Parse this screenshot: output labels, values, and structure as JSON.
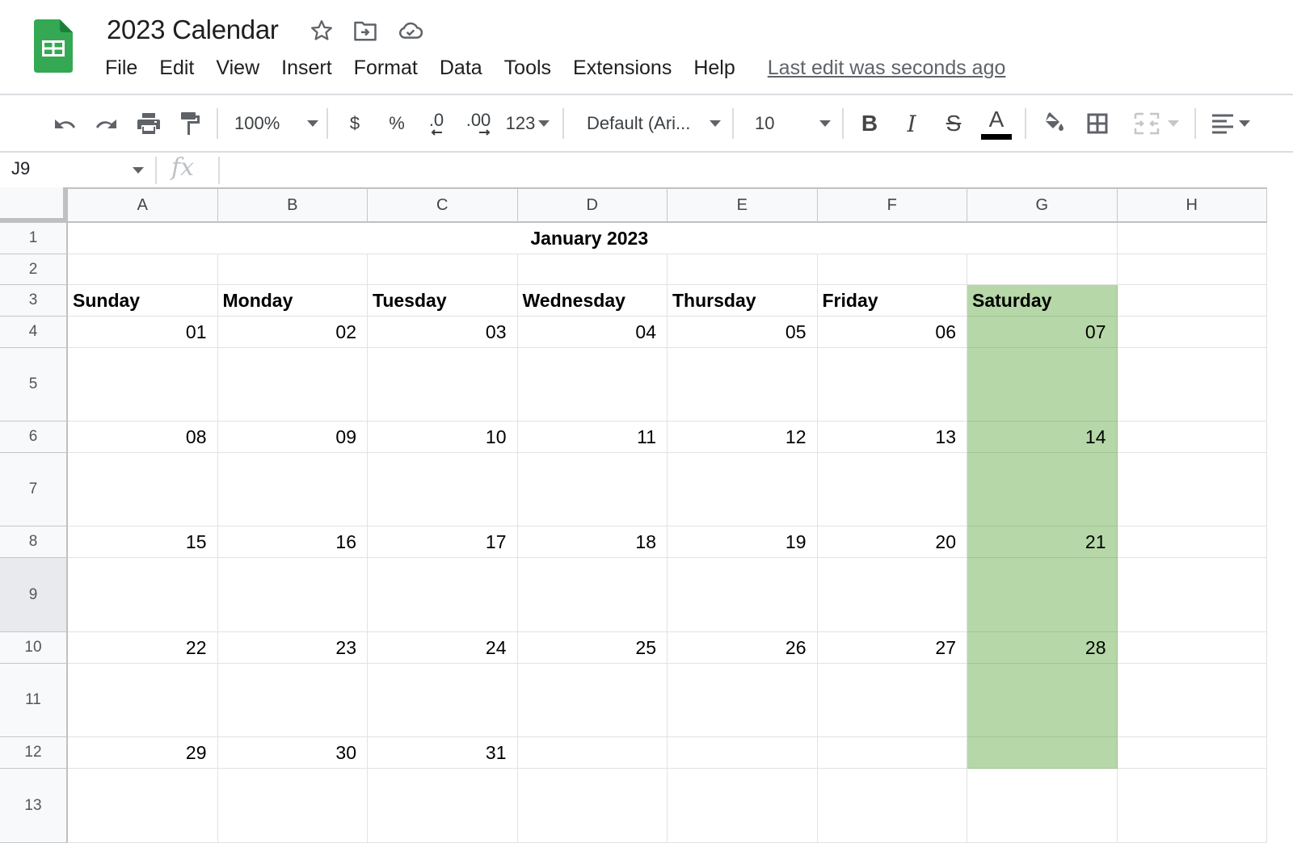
{
  "app": {
    "document_title": "2023 Calendar",
    "logo_icon": "google-sheets-logo",
    "title_icons": [
      "star-icon",
      "move-to-folder-icon",
      "cloud-saved-icon"
    ],
    "menu": [
      "File",
      "Edit",
      "View",
      "Insert",
      "Format",
      "Data",
      "Tools",
      "Extensions",
      "Help"
    ],
    "last_edit": "Last edit was seconds ago"
  },
  "toolbar": {
    "undo_icon": "undo-icon",
    "redo_icon": "redo-icon",
    "print_icon": "print-icon",
    "paint_format_icon": "paint-format-icon",
    "zoom": "100%",
    "currency": "$",
    "percent": "%",
    "decrease_decimal": ".0",
    "increase_decimal": ".00",
    "more_formats": "123",
    "font": "Default (Ari...",
    "font_size": "10",
    "bold": "B",
    "italic": "I",
    "strikethrough": "S",
    "text_color": "A",
    "text_color_value": "#000000",
    "fill_color_icon": "fill-color-icon",
    "borders_icon": "borders-icon",
    "merge_icon": "merge-cells-icon",
    "align_icon": "horizontal-align-icon"
  },
  "formula_bar": {
    "name_box": "J9",
    "fx_label": "fx",
    "value": ""
  },
  "sheet": {
    "columns": [
      "A",
      "B",
      "C",
      "D",
      "E",
      "F",
      "G",
      "H"
    ],
    "rows": [
      "1",
      "2",
      "3",
      "4",
      "5",
      "6",
      "7",
      "8",
      "9",
      "10",
      "11",
      "12",
      "13"
    ],
    "selected_row": "9",
    "title": "January 2023",
    "weekdays": [
      "Sunday",
      "Monday",
      "Tuesday",
      "Wednesday",
      "Thursday",
      "Friday",
      "Saturday"
    ],
    "weeks": [
      [
        "01",
        "02",
        "03",
        "04",
        "05",
        "06",
        "07"
      ],
      [
        "08",
        "09",
        "10",
        "11",
        "12",
        "13",
        "14"
      ],
      [
        "15",
        "16",
        "17",
        "18",
        "19",
        "20",
        "21"
      ],
      [
        "22",
        "23",
        "24",
        "25",
        "26",
        "27",
        "28"
      ],
      [
        "29",
        "30",
        "31",
        "",
        "",
        "",
        ""
      ]
    ],
    "weekend_fill_color": "#b6d7a8"
  }
}
